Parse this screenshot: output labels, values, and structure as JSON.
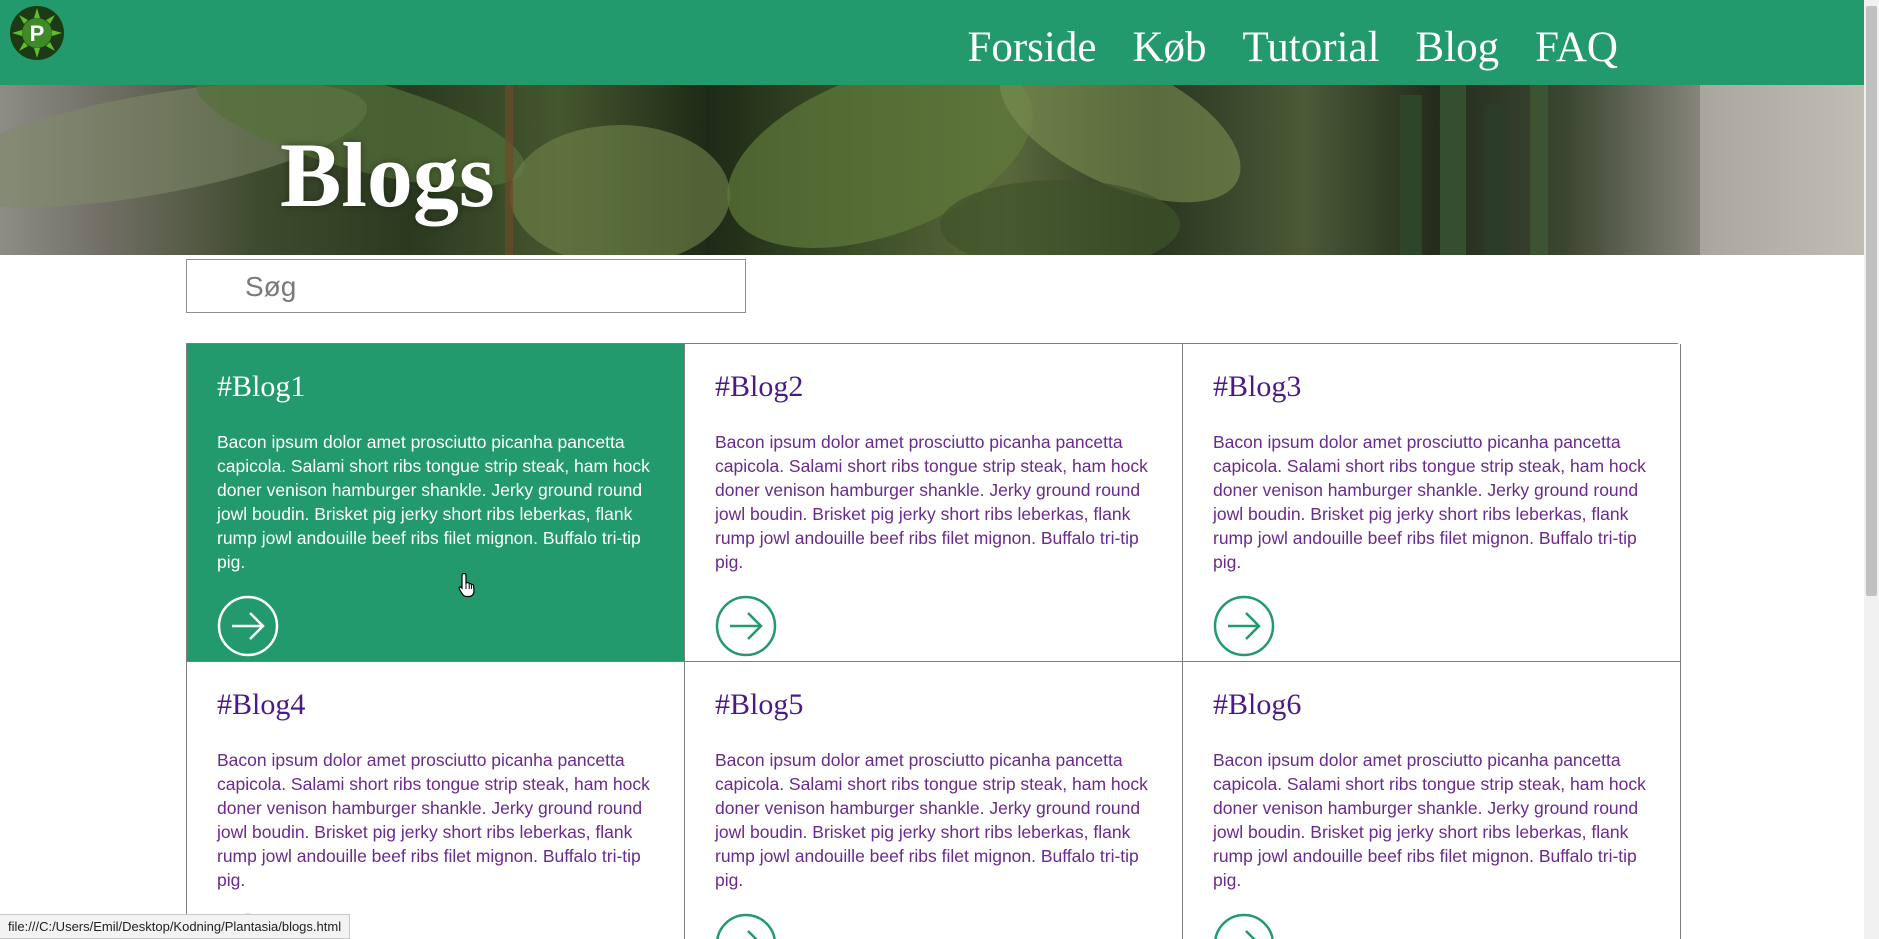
{
  "header": {
    "logo_letter": "P",
    "nav": [
      {
        "label": "Forside"
      },
      {
        "label": "Køb"
      },
      {
        "label": "Tutorial"
      },
      {
        "label": "Blog"
      },
      {
        "label": "FAQ"
      }
    ]
  },
  "hero": {
    "title": "Blogs"
  },
  "search": {
    "placeholder": "Søg",
    "value": ""
  },
  "blogs": [
    {
      "title": "#Blog1",
      "text": "Bacon ipsum dolor amet prosciutto picanha pancetta capicola. Salami short ribs tongue strip steak, ham hock doner venison hamburger shankle. Jerky ground round jowl boudin. Brisket pig jerky short ribs leberkas, flank rump jowl andouille beef ribs filet mignon. Buffalo tri-tip pig.",
      "active": true
    },
    {
      "title": "#Blog2",
      "text": "Bacon ipsum dolor amet prosciutto picanha pancetta capicola. Salami short ribs tongue strip steak, ham hock doner venison hamburger shankle. Jerky ground round jowl boudin. Brisket pig jerky short ribs leberkas, flank rump jowl andouille beef ribs filet mignon. Buffalo tri-tip pig.",
      "active": false
    },
    {
      "title": "#Blog3",
      "text": "Bacon ipsum dolor amet prosciutto picanha pancetta capicola. Salami short ribs tongue strip steak, ham hock doner venison hamburger shankle. Jerky ground round jowl boudin. Brisket pig jerky short ribs leberkas, flank rump jowl andouille beef ribs filet mignon. Buffalo tri-tip pig.",
      "active": false
    },
    {
      "title": "#Blog4",
      "text": "Bacon ipsum dolor amet prosciutto picanha pancetta capicola. Salami short ribs tongue strip steak, ham hock doner venison hamburger shankle. Jerky ground round jowl boudin. Brisket pig jerky short ribs leberkas, flank rump jowl andouille beef ribs filet mignon. Buffalo tri-tip pig.",
      "active": false
    },
    {
      "title": "#Blog5",
      "text": "Bacon ipsum dolor amet prosciutto picanha pancetta capicola. Salami short ribs tongue strip steak, ham hock doner venison hamburger shankle. Jerky ground round jowl boudin. Brisket pig jerky short ribs leberkas, flank rump jowl andouille beef ribs filet mignon. Buffalo tri-tip pig.",
      "active": false
    },
    {
      "title": "#Blog6",
      "text": "Bacon ipsum dolor amet prosciutto picanha pancetta capicola. Salami short ribs tongue strip steak, ham hock doner venison hamburger shankle. Jerky ground round jowl boudin. Brisket pig jerky short ribs leberkas, flank rump jowl andouille beef ribs filet mignon. Buffalo tri-tip pig.",
      "active": false
    }
  ],
  "status_bar": {
    "url": "file:///C:/Users/Emil/Desktop/Kodning/Plantasia/blogs.html"
  },
  "colors": {
    "brand_green": "#229a6b",
    "text_purple": "#6a2a8e",
    "title_purple": "#4b1a86"
  },
  "icons": {
    "logo": "plantasia-logo-icon",
    "arrow": "arrow-right-circle-icon",
    "cursor": "hand-pointer-icon"
  }
}
